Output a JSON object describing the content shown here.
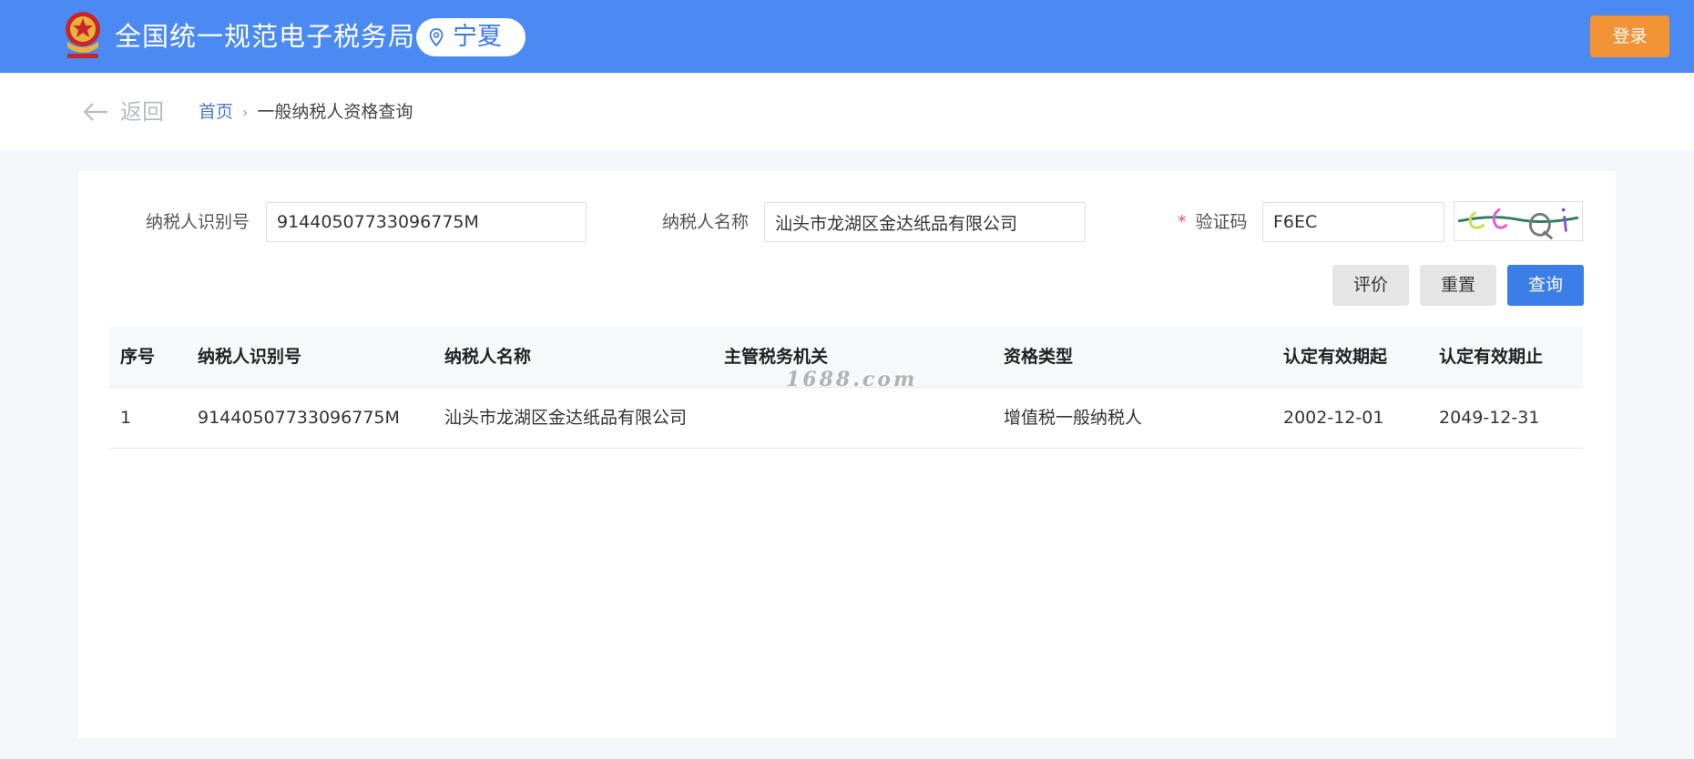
{
  "header": {
    "site_title": "全国统一规范电子税务局",
    "region": "宁夏",
    "login_label": "登录",
    "brand_color": "#4b8af2",
    "login_color": "#f29336"
  },
  "nav": {
    "back_label": "返回",
    "breadcrumb": {
      "home": "首页",
      "separator": "›",
      "current": "一般纳税人资格查询"
    }
  },
  "form": {
    "taxpayer_id": {
      "label": "纳税人识别号",
      "value": "91440507733096775M"
    },
    "taxpayer_name": {
      "label": "纳税人名称",
      "value": "汕头市龙湖区金达纸品有限公司"
    },
    "captcha": {
      "required_mark": "*",
      "label": "验证码",
      "value": "F6EC"
    },
    "buttons": {
      "evaluate": "评价",
      "reset": "重置",
      "query": "查询"
    },
    "query_button_color": "#3b7ee8"
  },
  "table": {
    "columns": [
      "序号",
      "纳税人识别号",
      "纳税人名称",
      "主管税务机关",
      "资格类型",
      "认定有效期起",
      "认定有效期止"
    ],
    "rows": [
      [
        "1",
        "91440507733096775M",
        "汕头市龙湖区金达纸品有限公司",
        "",
        "增值税一般纳税人",
        "2002-12-01",
        "2049-12-31"
      ]
    ]
  },
  "watermark": "1688.com"
}
